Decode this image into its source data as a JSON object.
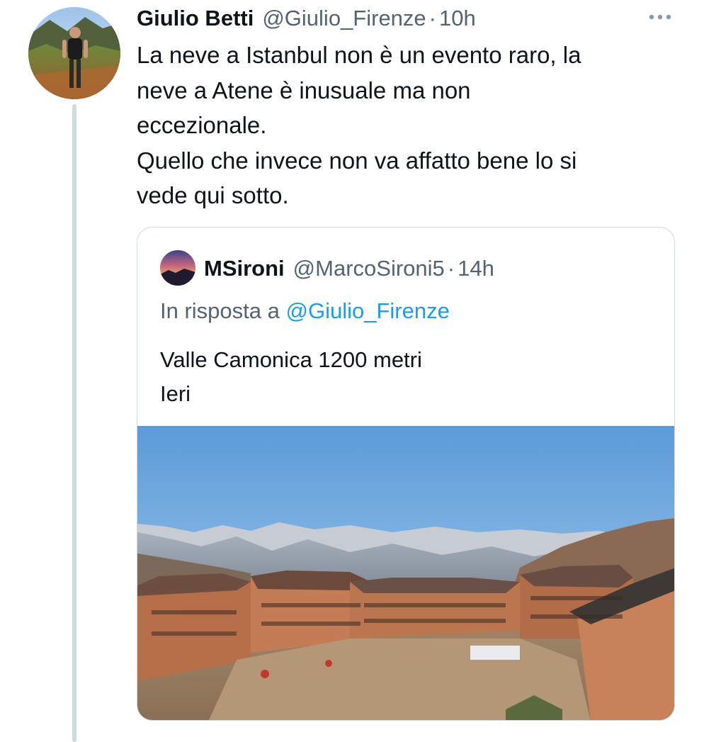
{
  "tweet": {
    "author_name": "Giulio Betti",
    "author_handle": "@Giulio_Firenze",
    "separator": "·",
    "time": "10h",
    "more_icon": "more-horizontal-icon",
    "text_lines": [
      "La neve a Istanbul non è un evento raro, la",
      "neve a Atene è inusuale ma non",
      "eccezionale.",
      "Quello che invece non va affatto bene lo si",
      "vede qui sotto."
    ]
  },
  "quote": {
    "author_name": "MSironi",
    "author_handle": "@MarcoSironi5",
    "separator": "·",
    "time": "14h",
    "reply_prefix": "In risposta a",
    "reply_handle": "@Giulio_Firenze",
    "text_lines": [
      "Valle Camonica 1200 metri",
      "Ieri"
    ]
  },
  "colors": {
    "text_primary": "#0f1419",
    "text_secondary": "#536471",
    "link": "#1d9bf0",
    "border": "#cfd9de",
    "thread_line": "#cfd9de"
  }
}
